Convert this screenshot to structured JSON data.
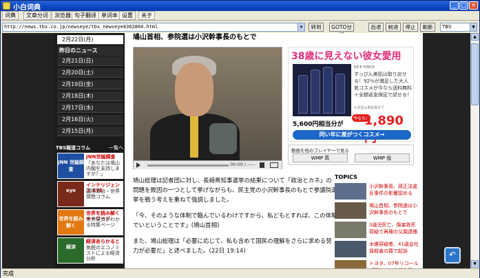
{
  "window": {
    "title": "小白词典"
  },
  "menu": [
    "词典",
    "文章分词",
    "浏览器",
    "句子翻译",
    "单词本",
    "设置",
    "关于"
  ],
  "address": {
    "url": "http://news.tbs.co.jp/newseye/tbs_newseye4362804.html",
    "buttons": [
      "转到",
      "GOTO分词",
      "后退",
      "前进",
      "停止",
      "刷新"
    ],
    "site_select": "TBS"
  },
  "sidebar": {
    "dates": [
      "2月22日(月)",
      "2月21日(日)",
      "2月20日(土)",
      "2月19日(金)",
      "2月18日(木)",
      "2月17日(水)",
      "2月16日(火)",
      "2月15日(月)"
    ],
    "yesterday_label": "昨日のニュース",
    "column_header": "TBS報道コラム",
    "column_more": "一覧へ",
    "columns": [
      {
        "thumb": "JNN 世論調査",
        "title": "JNN世論調査",
        "desc": "「あなたは鳩山内閣を支持しますか？」"
      },
      {
        "thumb": "eye",
        "title": "インテリジェンス EYE",
        "desc": "国際政治・世界情勢コラム"
      },
      {
        "thumb": "世界を読み解く",
        "title": "世界を読み解くキーワード",
        "desc": "世界経済がわかる特集ページ"
      },
      {
        "thumb": "経済",
        "title": "経済あらかると",
        "desc": "気鋭のエコノミストによる経済分析"
      }
    ]
  },
  "article": {
    "headline": "鳩山首相、参院選は小沢幹事長のもとで",
    "paragraphs": [
      "鳩山総理は記者団に対し、長崎県知事選挙の結果について「政治とカネ」の問題を敗因の一つとして挙げながらも、民主党の小沢幹事長のもとで参議院選挙を戦う考えを重ねて強調しました。",
      "「今、そのような体制で臨んでいるわけですから、私どもとすれば、この体制でいということです」(鳩山首相)",
      "また、鳩山総理は「必要に応じて、私も含めて国民の理解をさらに求める努力が必要だ」と述べました。(22日 19:14)"
    ]
  },
  "video": {
    "time": "00:00 / --:--"
  },
  "ad": {
    "headline": "38歳に見えない彼女愛用",
    "brand": "RICE FORCE",
    "text": "すっぴん美肌は取り戻せる！92％が満足した大人気コスメが今なら送料無料＋全額返金保証で試せる！",
    "note": "※浸透は角質層まで",
    "price_regular": "5,600円相当分が",
    "badge": "今なら!!",
    "price_sale": "1,890円",
    "cta": "同い年に差がつくコスメ→"
  },
  "player": {
    "label": "動画を他のプレイヤーで見る",
    "buttons": [
      "WMP 高",
      "WMP 低"
    ]
  },
  "topics": {
    "header": "TOPICS",
    "items": [
      "小沢幹事長、政正法違反事件の影響認める",
      "鳩山首相、参院選は小沢幹事長のもとで",
      "3歳児死亡、傷害致死容疑で再捜の父親逮捕",
      "木螺容疑者、41歳会社員殺害の罪で起訴",
      "トヨタ、07年リコール「節約との内部文書"
    ]
  },
  "status": "完成"
}
